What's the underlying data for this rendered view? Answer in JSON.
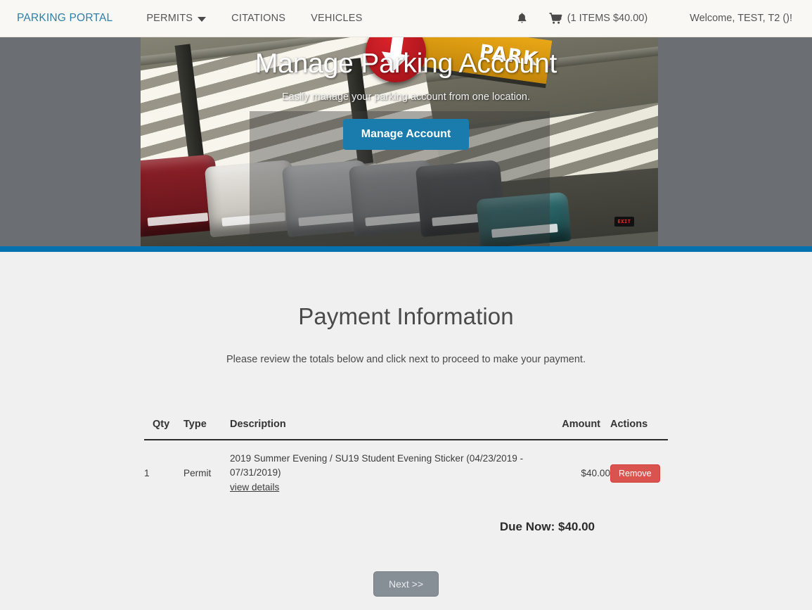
{
  "navbar": {
    "brand": "PARKING PORTAL",
    "links": [
      {
        "label": "PERMITS",
        "has_caret": true
      },
      {
        "label": "CITATIONS",
        "has_caret": false
      },
      {
        "label": "VEHICLES",
        "has_caret": false
      }
    ],
    "bell_icon": "bell-icon",
    "cart_icon": "shopping-cart-icon",
    "cart_label": "(1 ITEMS $40.00)",
    "welcome": "Welcome, TEST, T2 ()!",
    "brand_color": "#2e7fa8",
    "background": "#faf8f4"
  },
  "hero": {
    "title": "Manage Parking Account",
    "subtitle": "Easily manage your parking account from one location.",
    "button_label": "Manage Account",
    "button_color": "#1a7cad",
    "rule_color": "#0571ae",
    "sign_text": "PARK",
    "exit_sign_text": "EXIT"
  },
  "main": {
    "title": "Payment Information",
    "subtitle": "Please review the totals below and click next to proceed to make your payment.",
    "table": {
      "headers": [
        "Qty",
        "Type",
        "Description",
        "Amount",
        "Actions"
      ],
      "rows": [
        {
          "qty": "1",
          "type": "Permit",
          "description": "2019 Summer Evening / SU19 Student Evening Sticker (04/23/2019 - 07/31/2019)",
          "details_link": "view details",
          "amount": "$40.00",
          "action_label": "Remove",
          "action_color": "#d9534f"
        }
      ]
    },
    "due_now": "Due Now: $40.00",
    "next_label": "Next >>",
    "next_color": "#868e96"
  }
}
